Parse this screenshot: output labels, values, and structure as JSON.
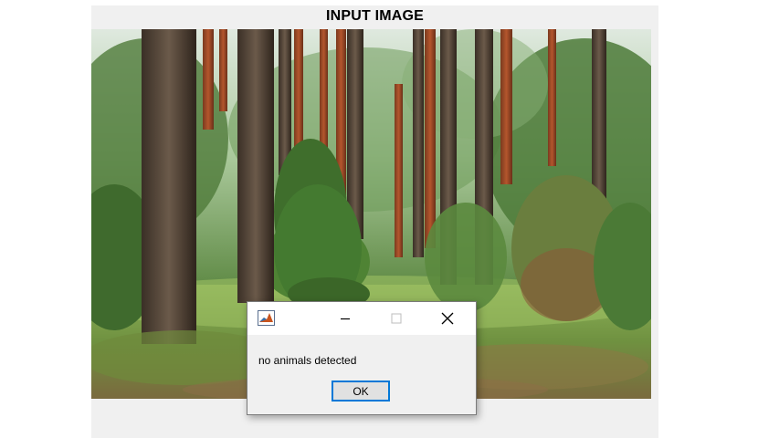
{
  "figure": {
    "title": "INPUT IMAGE",
    "image_description_icon": "forest-photo"
  },
  "dialog": {
    "app_icon": "matlab-icon",
    "minimize_icon": "minimize-icon",
    "maximize_icon": "maximize-icon",
    "close_icon": "close-icon",
    "message": "no animals detected",
    "ok_label": "OK"
  },
  "colors": {
    "figure_bg": "#f0f0f0",
    "dialog_bg": "#f0f0f0",
    "ok_border": "#0078d7"
  }
}
